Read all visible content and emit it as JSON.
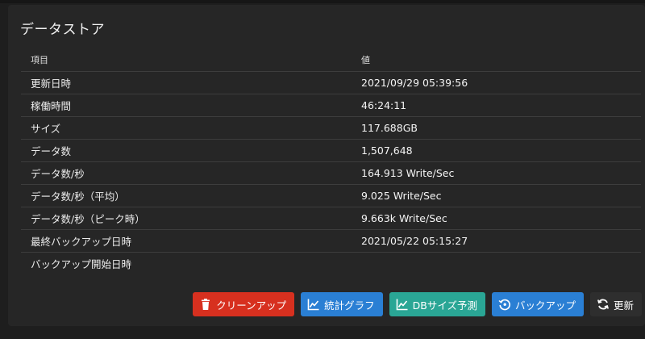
{
  "panel": {
    "title": "データストア"
  },
  "table": {
    "headers": {
      "key": "項目",
      "value": "値"
    },
    "rows": [
      {
        "key": "更新日時",
        "value": "2021/09/29 05:39:56"
      },
      {
        "key": "稼働時間",
        "value": "46:24:11"
      },
      {
        "key": "サイズ",
        "value": "117.688GB"
      },
      {
        "key": "データ数",
        "value": "1,507,648"
      },
      {
        "key": "データ数/秒",
        "value": "164.913 Write/Sec"
      },
      {
        "key": "データ数/秒（平均）",
        "value": "9.025 Write/Sec"
      },
      {
        "key": "データ数/秒（ピーク時）",
        "value": "9.663k Write/Sec"
      },
      {
        "key": "最終バックアップ日時",
        "value": "2021/05/22 05:15:27"
      },
      {
        "key": "バックアップ開始日時",
        "value": ""
      }
    ]
  },
  "actions": {
    "cleanup": {
      "label": "クリーンアップ",
      "icon": "trash-icon",
      "color": "#d7301f"
    },
    "stats_graph": {
      "label": "統計グラフ",
      "icon": "line-chart-icon",
      "color": "#2a7fd4"
    },
    "db_size_forecast": {
      "label": "DBサイズ予測",
      "icon": "line-chart-icon",
      "color": "#2aa695"
    },
    "backup": {
      "label": "バックアップ",
      "icon": "backup-icon",
      "color": "#2a7fd4"
    },
    "refresh": {
      "label": "更新",
      "icon": "refresh-icon",
      "color": "#2e2e2e"
    }
  }
}
